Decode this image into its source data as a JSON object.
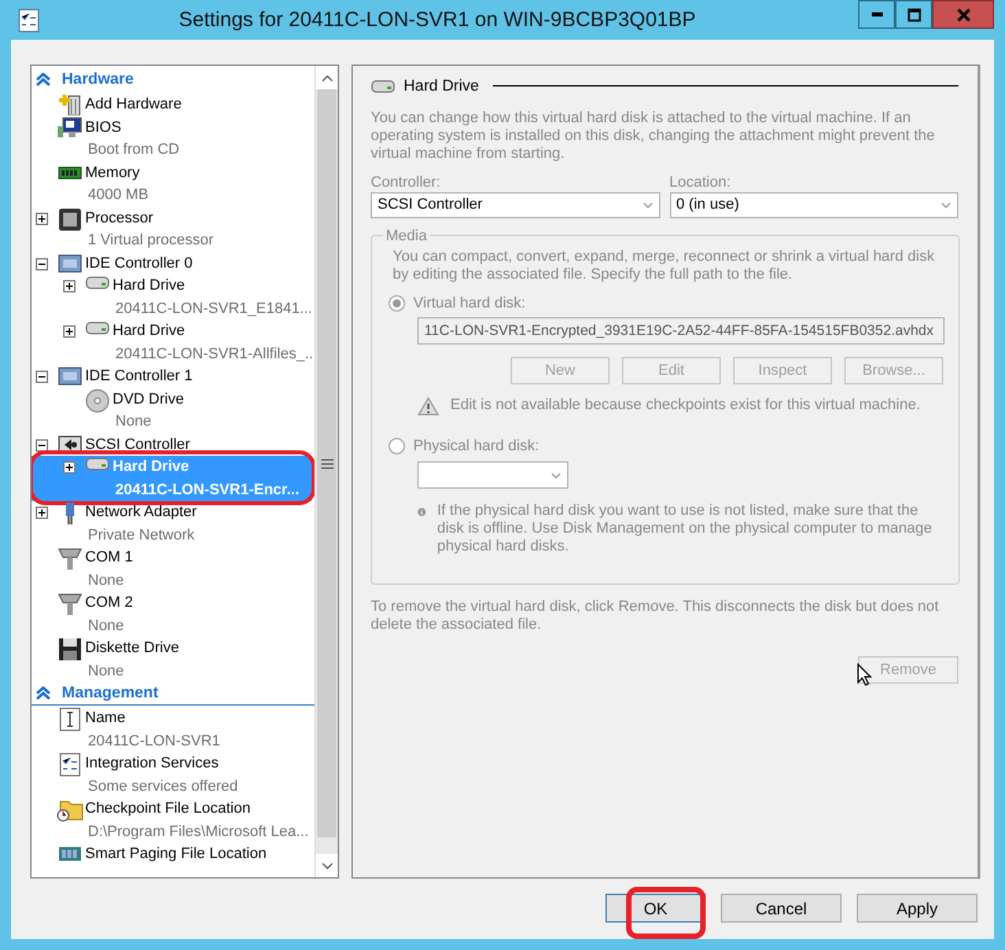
{
  "window": {
    "title": "Settings for 20411C-LON-SVR1 on WIN-9BCBP3Q01BP"
  },
  "sidebar": {
    "sections": [
      {
        "title": "Hardware",
        "items": [
          {
            "kind": "add",
            "name": "Add Hardware",
            "selected": false,
            "circled": false
          },
          {
            "kind": "bios",
            "name": "BIOS",
            "sub": "Boot from CD",
            "selected": false,
            "circled": false
          },
          {
            "kind": "memory",
            "name": "Memory",
            "sub": "4000 MB",
            "selected": false,
            "circled": false
          },
          {
            "kind": "cpu",
            "name": "Processor",
            "sub": "1 Virtual processor",
            "expanded": false,
            "selected": false,
            "circled": false
          },
          {
            "kind": "controller",
            "name": "IDE Controller 0",
            "expanded": true,
            "selected": false,
            "circled": false,
            "children": [
              {
                "kind": "disk",
                "name": "Hard Drive",
                "sub": "20411C-LON-SVR1_E1841...",
                "expanded": false,
                "selected": false,
                "circled": false
              },
              {
                "kind": "disk",
                "name": "Hard Drive",
                "sub": "20411C-LON-SVR1-Allfiles_...",
                "expanded": false,
                "selected": false,
                "circled": false
              }
            ]
          },
          {
            "kind": "controller",
            "name": "IDE Controller 1",
            "expanded": true,
            "selected": false,
            "circled": false,
            "children": [
              {
                "kind": "dvd",
                "name": "DVD Drive",
                "sub": "None",
                "selected": false,
                "circled": false
              }
            ]
          },
          {
            "kind": "scsi",
            "name": "SCSI Controller",
            "expanded": true,
            "selected": false,
            "circled": false,
            "children": [
              {
                "kind": "disk",
                "name": "Hard Drive",
                "sub": "20411C-LON-SVR1-Encr...",
                "expanded": false,
                "selected": true,
                "circled": true
              }
            ]
          },
          {
            "kind": "network",
            "name": "Network Adapter",
            "sub": "Private Network",
            "expanded": false,
            "selected": false,
            "circled": false
          },
          {
            "kind": "com",
            "name": "COM 1",
            "sub": "None",
            "selected": false,
            "circled": false
          },
          {
            "kind": "com",
            "name": "COM 2",
            "sub": "None",
            "selected": false,
            "circled": false
          },
          {
            "kind": "floppy",
            "name": "Diskette Drive",
            "sub": "None",
            "selected": false,
            "circled": false
          }
        ]
      },
      {
        "title": "Management",
        "items": [
          {
            "kind": "name",
            "name": "Name",
            "sub": "20411C-LON-SVR1",
            "selected": false,
            "circled": false
          },
          {
            "kind": "services",
            "name": "Integration Services",
            "sub": "Some services offered",
            "selected": false,
            "circled": false
          },
          {
            "kind": "folder",
            "name": "Checkpoint File Location",
            "sub": "D:\\Program Files\\Microsoft Lea...",
            "selected": false,
            "circled": false
          },
          {
            "kind": "paging",
            "name": "Smart Paging File Location",
            "selected": false,
            "circled": false
          }
        ]
      }
    ]
  },
  "details": {
    "title": "Hard Drive",
    "description": "You can change how this virtual hard disk is attached to the virtual machine. If an operating system is installed on this disk, changing the attachment might prevent the virtual machine from starting.",
    "controller": {
      "label": "Controller:",
      "value": "SCSI Controller"
    },
    "location": {
      "label": "Location:",
      "value": "0 (in use)"
    },
    "media": {
      "title": "Media",
      "disabled": true,
      "description": "You can compact, convert, expand, merge, reconnect or shrink a virtual hard disk by editing the associated file. Specify the full path to the file.",
      "options": [
        {
          "kind": "virtual",
          "label": "Virtual hard disk:",
          "selected": true,
          "path": "11C-LON-SVR1-Encrypted_3931E19C-2A52-44FF-85FA-154515FB0352.avhdx",
          "buttons": [
            {
              "label": "New",
              "disabled": true
            },
            {
              "label": "Edit",
              "disabled": true
            },
            {
              "label": "Inspect",
              "disabled": true
            },
            {
              "label": "Browse...",
              "disabled": true
            }
          ],
          "note": "Edit is not available because checkpoints exist for this virtual machine."
        },
        {
          "kind": "physical",
          "label": "Physical hard disk:",
          "selected": false,
          "note": "If the physical hard disk you want to use is not listed, make sure that the disk is offline. Use Disk Management on the physical computer to manage physical hard disks."
        }
      ]
    },
    "remove_text": "To remove the virtual hard disk, click Remove. This disconnects the disk but does not delete the associated file.",
    "remove_button": {
      "label": "Remove",
      "disabled": true
    }
  },
  "buttons": [
    {
      "label": "OK",
      "circled": true
    },
    {
      "label": "Cancel",
      "circled": false
    },
    {
      "label": "Apply",
      "circled": false
    }
  ]
}
